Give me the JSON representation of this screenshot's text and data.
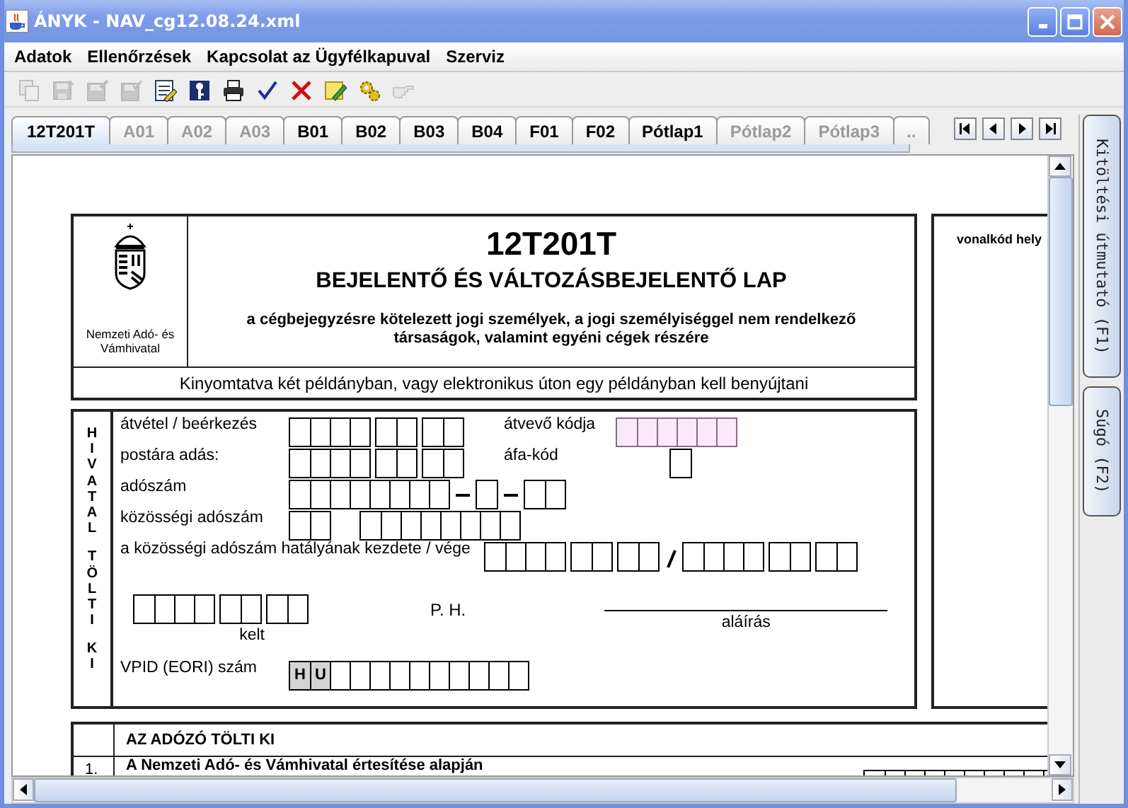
{
  "window": {
    "title": "ÁNYK - NAV_cg12.08.24.xml"
  },
  "menu": [
    "Adatok",
    "Ellenőrzések",
    "Kapcsolat az Ügyfélkapuval",
    "Szerviz"
  ],
  "toolbar": [
    {
      "kind": "copy",
      "disabled": true
    },
    {
      "kind": "save",
      "disabled": true
    },
    {
      "kind": "save_edit",
      "disabled": true
    },
    {
      "kind": "save_check",
      "disabled": true
    },
    {
      "kind": "notepad",
      "disabled": false
    },
    {
      "kind": "key",
      "disabled": false
    },
    {
      "kind": "print",
      "disabled": false
    },
    {
      "kind": "check",
      "disabled": false
    },
    {
      "kind": "delete",
      "disabled": false
    },
    {
      "kind": "note",
      "disabled": false
    },
    {
      "kind": "gears",
      "disabled": false
    },
    {
      "kind": "hand",
      "disabled": true
    }
  ],
  "tabs": [
    {
      "label": "12T201T",
      "selected": true,
      "disabled": false
    },
    {
      "label": "A01",
      "selected": false,
      "disabled": true
    },
    {
      "label": "A02",
      "selected": false,
      "disabled": true
    },
    {
      "label": "A03",
      "selected": false,
      "disabled": true
    },
    {
      "label": "B01",
      "selected": false,
      "disabled": false
    },
    {
      "label": "B02",
      "selected": false,
      "disabled": false
    },
    {
      "label": "B03",
      "selected": false,
      "disabled": false
    },
    {
      "label": "B04",
      "selected": false,
      "disabled": false
    },
    {
      "label": "F01",
      "selected": false,
      "disabled": false
    },
    {
      "label": "F02",
      "selected": false,
      "disabled": false
    },
    {
      "label": "Pótlap1",
      "selected": false,
      "disabled": false
    },
    {
      "label": "Pótlap2",
      "selected": false,
      "disabled": true
    },
    {
      "label": "Pótlap3",
      "selected": false,
      "disabled": true
    },
    {
      "label": "..",
      "selected": false,
      "disabled": true
    }
  ],
  "side_tabs": [
    "Kitöltési útmutató (F1)",
    "Súgó (F2)"
  ],
  "form": {
    "code": "12T201T",
    "title": "BEJELENTŐ ÉS VÁLTOZÁSBEJELENTŐ LAP",
    "subtitle": "a cégbejegyzésre kötelezett jogi személyek, a jogi személyiséggel nem rendelkező társaságok, valamint egyéni cégek részére",
    "authority": "Nemzeti Adó- és Vámhivatal",
    "print_note": "Kinyomtatva két példányban, vagy elektronikus úton egy példányban kell benyújtani",
    "barcode_label": "vonalkód hely",
    "office": {
      "side_label": [
        "HIVATAL",
        "TÖLTI",
        "KI"
      ],
      "fields": [
        {
          "label": "átvétel / beérkezés",
          "locked": false
        },
        {
          "label": "átvevő kódja",
          "locked": true
        },
        {
          "label": "postára adás:",
          "locked": false
        },
        {
          "label": "áfa-kód",
          "locked": false
        },
        {
          "label": "adószám",
          "locked": false
        },
        {
          "label": "közösségi adószám",
          "locked": false
        },
        {
          "label": "a közösségi adószám hatályának kezdete / vége",
          "locked": false
        }
      ],
      "date_label": "kelt",
      "stamp_label": "P. H.",
      "signature_label": "aláírás",
      "vpid": {
        "label": "VPID (EORI) szám",
        "prefix": [
          "H",
          "U"
        ]
      }
    },
    "taxpayer": {
      "heading": "AZ ADÓZÓ TÖLTI KI",
      "rows": [
        {
          "number": "1.",
          "text": "A Nemzeti Adó- és Vámhivatal értesítése alapján"
        }
      ]
    }
  }
}
